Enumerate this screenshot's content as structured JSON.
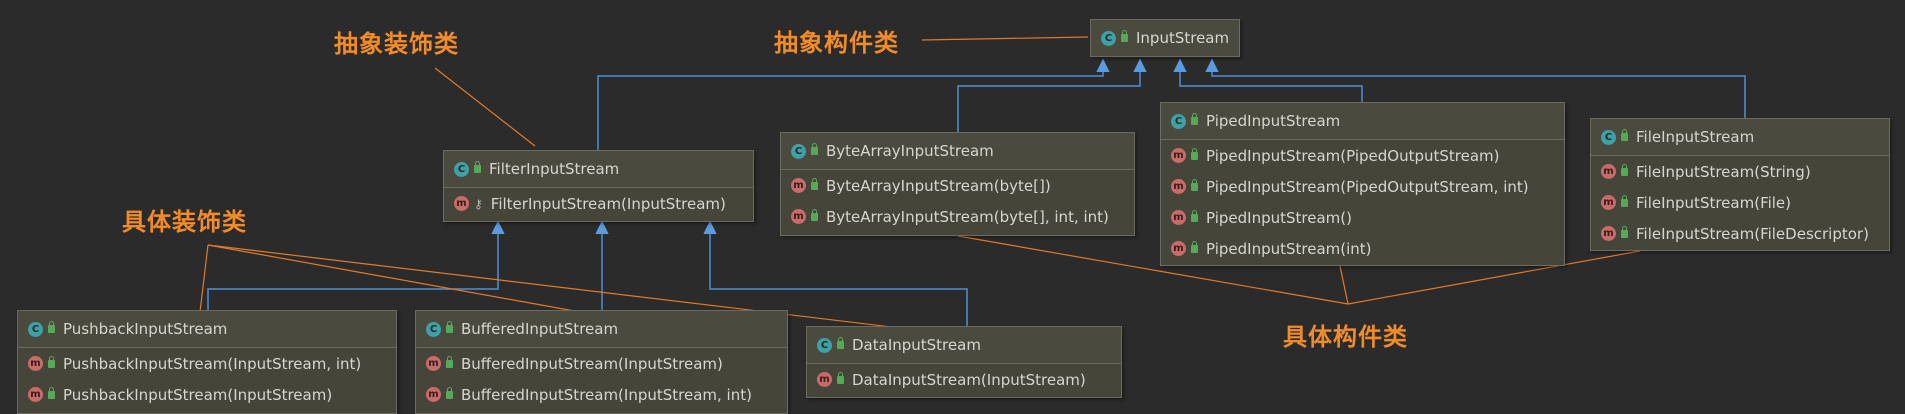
{
  "labels": {
    "abstract_decorator": "抽象装饰类",
    "abstract_component": "抽象构件类",
    "concrete_decorator": "具体装饰类",
    "concrete_component": "具体构件类"
  },
  "classes": {
    "input_stream": {
      "name": "InputStream"
    },
    "filter_input_stream": {
      "name": "FilterInputStream",
      "members": [
        "FilterInputStream(InputStream)"
      ]
    },
    "byte_array_input_stream": {
      "name": "ByteArrayInputStream",
      "members": [
        "ByteArrayInputStream(byte[])",
        "ByteArrayInputStream(byte[], int, int)"
      ]
    },
    "piped_input_stream": {
      "name": "PipedInputStream",
      "members": [
        "PipedInputStream(PipedOutputStream)",
        "PipedInputStream(PipedOutputStream, int)",
        "PipedInputStream()",
        "PipedInputStream(int)"
      ]
    },
    "file_input_stream": {
      "name": "FileInputStream",
      "members": [
        "FileInputStream(String)",
        "FileInputStream(File)",
        "FileInputStream(FileDescriptor)"
      ]
    },
    "pushback_input_stream": {
      "name": "PushbackInputStream",
      "members": [
        "PushbackInputStream(InputStream, int)",
        "PushbackInputStream(InputStream)"
      ]
    },
    "buffered_input_stream": {
      "name": "BufferedInputStream",
      "members": [
        "BufferedInputStream(InputStream)",
        "BufferedInputStream(InputStream, int)"
      ]
    },
    "data_input_stream": {
      "name": "DataInputStream",
      "members": [
        "DataInputStream(InputStream)"
      ]
    }
  },
  "icons": {
    "class_badge": "C",
    "method_badge": "m"
  },
  "colors": {
    "background": "#2b2b2b",
    "label": "#f28c28",
    "inheritance_arrow": "#4f8fd6",
    "annotation_line": "#e07a2a"
  }
}
